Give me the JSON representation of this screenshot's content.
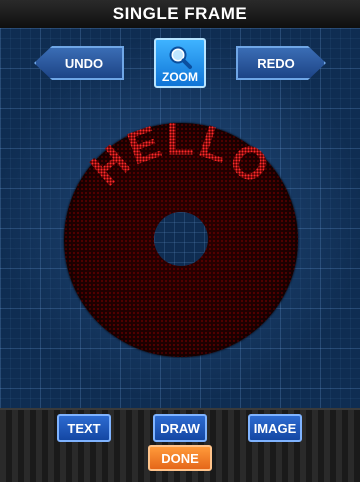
{
  "header": {
    "title": "SINGLE FRAME"
  },
  "controls": {
    "undo_label": "UNDO",
    "redo_label": "REDO",
    "zoom_label": "ZOOM"
  },
  "canvas": {
    "message": "HELLO",
    "led_color": "#ff2a2a",
    "disc_color": "#2b0000"
  },
  "toolbar": {
    "text_label": "TEXT",
    "draw_label": "DRAW",
    "image_label": "IMAGE",
    "done_label": "DONE"
  },
  "colors": {
    "accent_blue": "#1f6fd6",
    "done_orange": "#f07a25"
  }
}
